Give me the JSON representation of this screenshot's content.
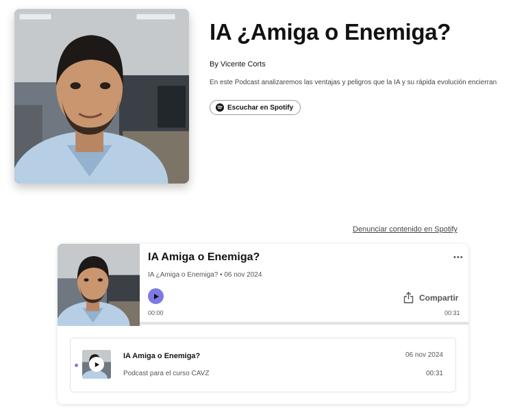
{
  "show": {
    "title": "IA ¿Amiga o Enemiga?",
    "author": "By Vicente Corts",
    "description": "En este Podcast analizaremos las ventajas y peligros que la IA y su rápida evolución encierran",
    "spotify_button_label": "Escuchar en Spotify",
    "cover_icon": "portrait-photo"
  },
  "report_link": "Denunciar contenido en Spotify",
  "embed": {
    "episode_title": "IA Amiga o Enemiga?",
    "episode_meta": "IA ¿Amiga o Enemiga? • 06 nov 2024",
    "more_icon": "more-icon",
    "share_label": "Compartir",
    "current_time": "00:00",
    "total_time": "00:31",
    "progress_fraction": 0,
    "accent_color": "#7f79e6"
  },
  "episode_list": [
    {
      "title": "IA Amiga o Enemiga?",
      "description": "Podcast para el curso CAVZ",
      "date": "06 nov 2024",
      "duration": "00:31",
      "active": true
    }
  ]
}
